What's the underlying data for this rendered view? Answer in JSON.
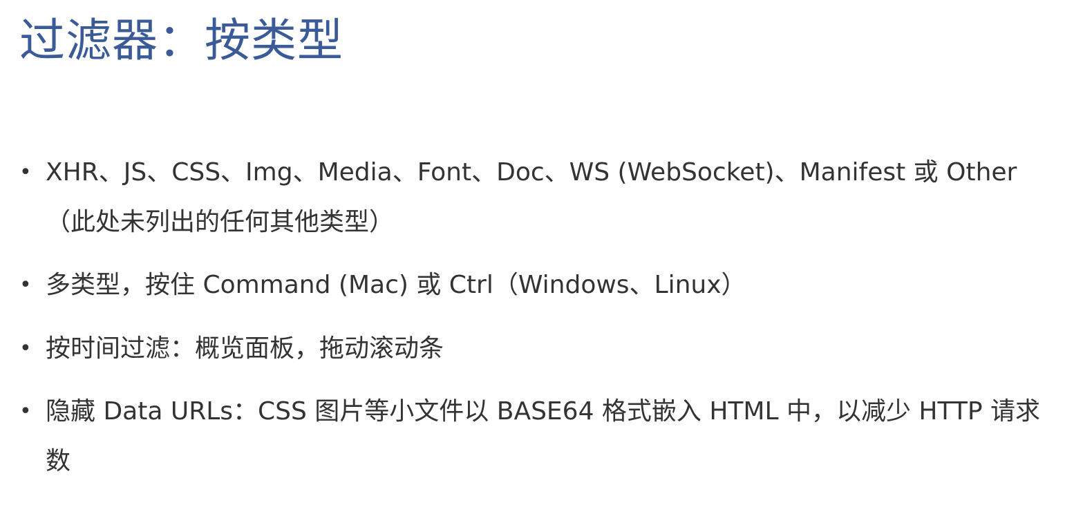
{
  "slide": {
    "title": "过滤器：按类型",
    "bullet_symbol": "•",
    "bullets": [
      {
        "text": "XHR、JS、CSS、Img、Media、Font、Doc、WS (WebSocket)、Manifest 或 Other（此处未列出的任何其他类型）"
      },
      {
        "text": "多类型，按住 Command (Mac) 或 Ctrl（Windows、Linux）"
      },
      {
        "text": "按时间过滤：概览面板，拖动滚动条"
      },
      {
        "text": "隐藏 Data URLs：CSS 图片等小文件以 BASE64 格式嵌入 HTML 中，以减少 HTTP 请求数"
      }
    ],
    "colors": {
      "title": "#3a5a98",
      "body_text": "#333333",
      "background": "#ffffff"
    }
  }
}
